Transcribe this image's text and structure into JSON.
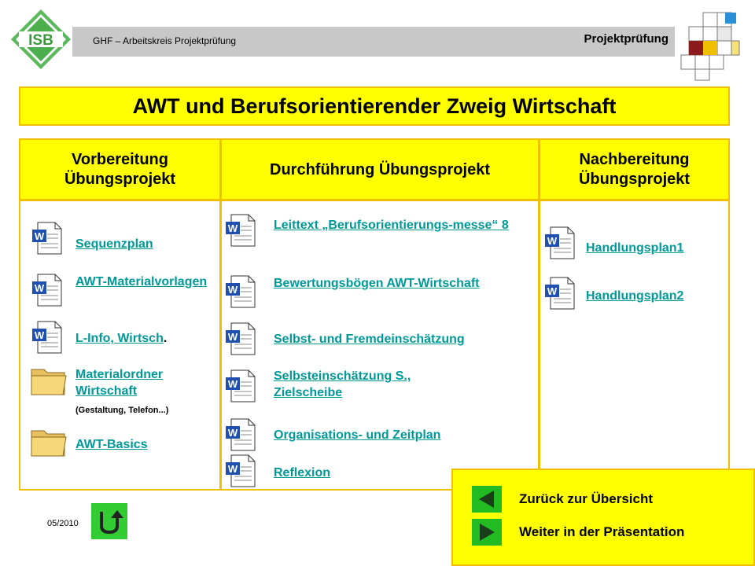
{
  "header": {
    "logo_text": "ISB",
    "subtitle": "GHF – Arbeitskreis Projektprüfung",
    "section": "Projektprüfung"
  },
  "title": "AWT und Berufsorientierender Zweig Wirtschaft",
  "columns": [
    {
      "heading": "Vorbereitung Übungsprojekt"
    },
    {
      "heading": "Durchführung Übungsprojekt"
    },
    {
      "heading": "Nachbereitung Übungsprojekt"
    }
  ],
  "col1": {
    "items": [
      {
        "icon": "word-doc-icon",
        "label": "Sequenzplan"
      },
      {
        "icon": "word-doc-icon",
        "label": "AWT-Materialvorlagen"
      },
      {
        "icon": "word-doc-icon",
        "label": "L-Info, Wirtsch",
        "suffix": "."
      },
      {
        "icon": "folder-icon",
        "label": "Materialordner Wirtschaft",
        "note": "(Gestaltung, Telefon...)"
      },
      {
        "icon": "folder-icon",
        "label": "AWT-Basics"
      }
    ]
  },
  "col2": {
    "items": [
      {
        "icon": "word-doc-icon",
        "label": "Leittext „Berufsorientierungs-messe“ 8"
      },
      {
        "icon": "word-doc-icon",
        "label": "Bewertungsbögen AWT-Wirtschaft"
      },
      {
        "icon": "word-doc-icon",
        "label": "Selbst- und Fremdeinschätzung"
      },
      {
        "icon": "word-doc-icon",
        "label": "Selbsteinschätzung S., Zielscheibe"
      },
      {
        "icon": "word-doc-icon",
        "label": "Organisations- und Zeitplan"
      },
      {
        "icon": "word-doc-icon",
        "label": "Reflexion"
      }
    ]
  },
  "col3": {
    "items": [
      {
        "icon": "word-doc-icon",
        "label": "Handlungsplan1"
      },
      {
        "icon": "word-doc-icon",
        "label": "Handlungsplan2"
      }
    ]
  },
  "footer": {
    "date": "05/2010",
    "nav_back": "Zurück zur Übersicht",
    "nav_next": "Weiter in der Präsentation"
  },
  "colors": {
    "yellow": "#ffff00",
    "border": "#f0c000",
    "link": "#009999",
    "green": "#22bb22",
    "header_gray": "#c8c8c8"
  }
}
